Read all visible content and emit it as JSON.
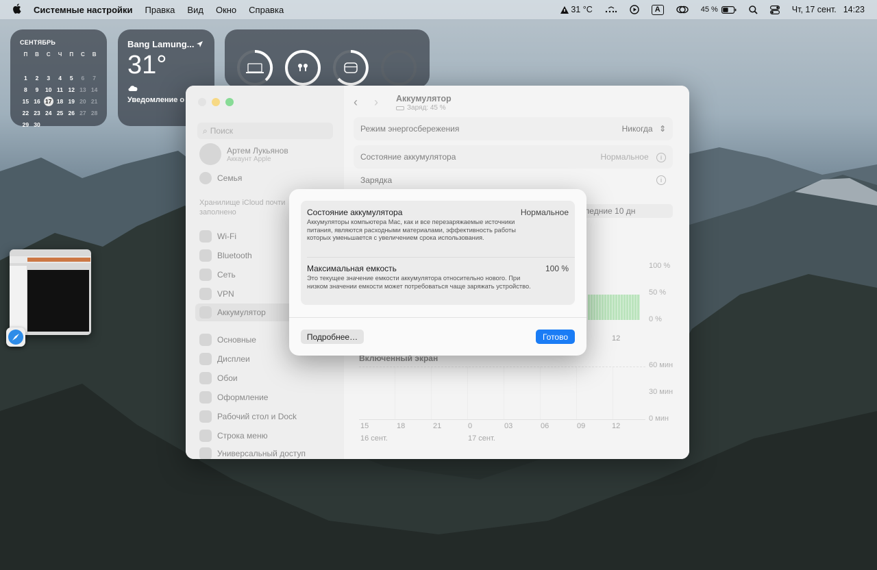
{
  "menubar": {
    "app_name": "Системные настройки",
    "items": [
      "Правка",
      "Вид",
      "Окно",
      "Справка"
    ],
    "weather": "31 °C",
    "input_source": "A",
    "battery_percent": "45 %",
    "datetime": "Чт, 17 сент.",
    "time": "14:23"
  },
  "calendar_widget": {
    "month": "СЕНТЯБРЬ",
    "weekdays": [
      "П",
      "В",
      "С",
      "Ч",
      "П",
      "С",
      "В"
    ],
    "weeks": [
      [
        "",
        "",
        "",
        "",
        "",
        "",
        ""
      ],
      [
        "",
        "",
        "",
        "",
        "",
        "",
        ""
      ],
      [
        "",
        "",
        "",
        "",
        "",
        "",
        ""
      ],
      [
        "",
        "",
        "",
        "",
        "",
        "",
        ""
      ],
      [
        "",
        "",
        "",
        "",
        "",
        "",
        ""
      ],
      [
        "",
        "",
        "",
        "",
        "",
        "",
        ""
      ]
    ],
    "days_flat": [
      "",
      "",
      "",
      "",
      "",
      "",
      "",
      "1",
      "2",
      "3",
      "4",
      "5",
      "6",
      "7",
      "8",
      "9",
      "10",
      "11",
      "12",
      "13",
      "14",
      "15",
      "16",
      "17",
      "18",
      "19",
      "20",
      "21",
      "22",
      "23",
      "24",
      "25",
      "26",
      "27",
      "28",
      "29",
      "30"
    ],
    "today": "17"
  },
  "weather_widget": {
    "city": "Bang Lamung...",
    "temperature": "31°",
    "note": "Уведомление о сильном дожде"
  },
  "window": {
    "search_placeholder": "Поиск",
    "user_name": "Артем Лукьянов",
    "user_sub": "Аккаунт Apple",
    "family": "Семья",
    "icloud": "Хранилище iCloud почти заполнено",
    "sidebar": [
      "Wi-Fi",
      "Bluetooth",
      "Сеть",
      "VPN",
      "Аккумулятор",
      "Основные",
      "Дисплеи",
      "Обои",
      "Оформление",
      "Рабочий стол и Dock",
      "Строка меню",
      "Универсальный доступ"
    ],
    "title": "Аккумулятор",
    "subtitle": "Заряд: 45 %",
    "low_power_label": "Режим энергосбережения",
    "low_power_value": "Никогда",
    "health_label": "Состояние аккумулятора",
    "health_value": "Нормальное",
    "charging_label": "Зарядка",
    "period_label": "Последние 10 дн",
    "level_ticks": [
      "100 %",
      "50 %",
      "0 %"
    ],
    "level_axis_label": "12",
    "screen_on_title": "Включенный экран",
    "screen_ticks": [
      "60 мин",
      "30 мин",
      "0 мин"
    ],
    "x_ticks": [
      "15",
      "18",
      "21",
      "0",
      "03",
      "06",
      "09",
      "12"
    ],
    "date_labels": [
      "16 сент.",
      "17 сент."
    ]
  },
  "modal": {
    "health_title": "Состояние аккумулятора",
    "health_value": "Нормальное",
    "health_desc": "Аккумуляторы компьютера Mac, как и все перезаряжаемые источники питания, являются расходными материалами, эффективность работы которых уменьшается с увеличением срока использования.",
    "capacity_title": "Максимальная емкость",
    "capacity_value": "100 %",
    "capacity_desc": "Это текущее значение емкости аккумулятора относительно нового. При низком значении емкости может потребоваться чаще заряжать устройство.",
    "more_button": "Подробнее…",
    "done_button": "Готово"
  },
  "colors": {
    "accent": "#1a7cf5",
    "close": "#e0443e",
    "minimize": "#f0b82e",
    "zoom": "#34c648"
  }
}
